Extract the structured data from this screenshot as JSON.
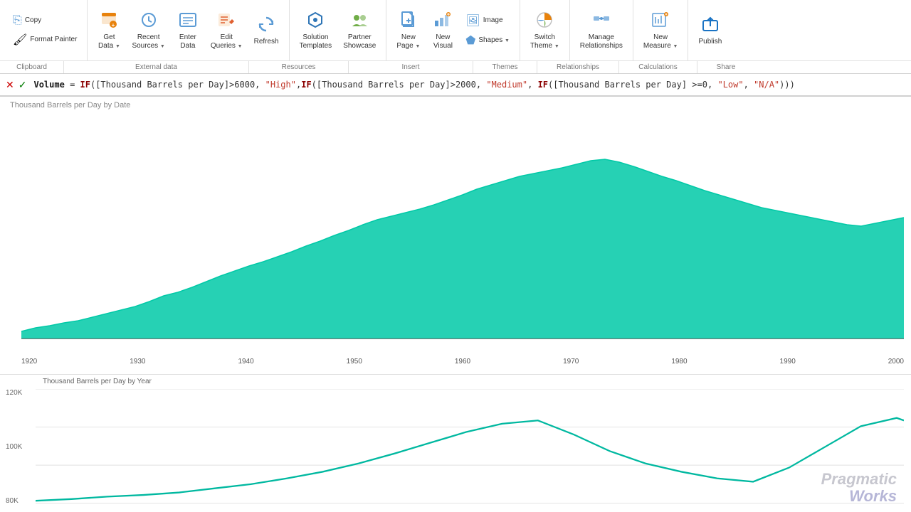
{
  "toolbar": {
    "groups": {
      "clipboard": {
        "label": "Clipboard",
        "copy_label": "Copy",
        "format_painter_label": "Format Painter"
      },
      "external_data": {
        "label": "External data",
        "get_data_label": "Get\nData",
        "recent_sources_label": "Recent\nSources",
        "enter_data_label": "Enter\nData",
        "edit_queries_label": "Edit\nQueries",
        "refresh_label": "Refresh"
      },
      "resources": {
        "label": "Resources",
        "solution_templates_label": "Solution\nTemplates",
        "partner_showcase_label": "Partner\nShowcase"
      },
      "insert": {
        "label": "Insert",
        "new_page_label": "New\nPage",
        "new_visual_label": "New\nVisual",
        "image_label": "Image",
        "shapes_label": "Shapes"
      },
      "themes": {
        "label": "Themes",
        "switch_theme_label": "Switch\nTheme"
      },
      "relationships": {
        "label": "Relationships",
        "manage_relationships_label": "Manage\nRelationships"
      },
      "calculations": {
        "label": "Calculations",
        "new_measure_label": "New\nMeasure"
      },
      "share": {
        "label": "Share",
        "publish_label": "Publish"
      }
    }
  },
  "formula_bar": {
    "formula": "Volume = IF([Thousand Barrels per Day]>6000, \"High\",IF([Thousand Barrels per Day]>2000, \"Medium\", IF([Thousand Barrels per Day] >=0, \"Low\", \"N/A\")))"
  },
  "charts": {
    "area_chart": {
      "title": "Thousand Barrels per Day by Date",
      "x_labels": [
        "1920",
        "1930",
        "1940",
        "1950",
        "1960",
        "1970",
        "1980",
        "1990",
        "2000"
      ]
    },
    "line_chart": {
      "title": "Thousand Barrels per Day by Year",
      "y_labels": [
        "120K",
        "100K",
        "80K"
      ]
    }
  },
  "watermark": {
    "line1": "Pragmatic",
    "line2": "Works"
  }
}
